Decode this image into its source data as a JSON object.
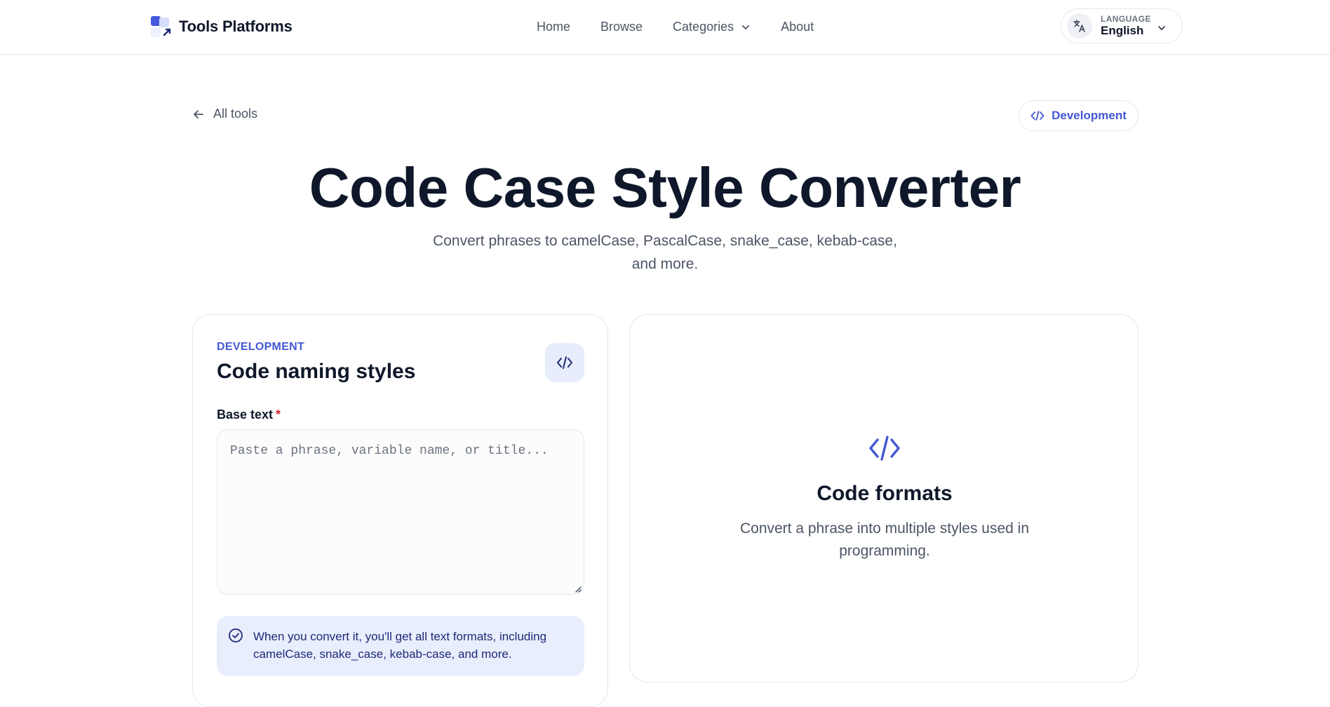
{
  "header": {
    "brand": "Tools Platforms",
    "nav": [
      {
        "label": "Home"
      },
      {
        "label": "Browse"
      },
      {
        "label": "Categories"
      },
      {
        "label": "About"
      }
    ],
    "language": {
      "label": "LANGUAGE",
      "value": "English"
    }
  },
  "page": {
    "back_label": "All tools",
    "category_pill": "Development",
    "title": "Code Case Style Converter",
    "subtitle": "Convert phrases to camelCase, PascalCase, snake_case, kebab-case, and more."
  },
  "form": {
    "eyebrow": "DEVELOPMENT",
    "title": "Code naming styles",
    "field_label": "Base text",
    "required_marker": "*",
    "placeholder": "Paste a phrase, variable name, or title...",
    "value": "",
    "notice": "When you convert it, you'll get all text formats, including camelCase, snake_case, kebab-case, and more."
  },
  "result": {
    "title": "Code formats",
    "description": "Convert a phrase into multiple styles used in programming."
  },
  "colors": {
    "accent": "#4458d4",
    "notice_bg": "#e9eefc",
    "required": "#dc2626"
  }
}
